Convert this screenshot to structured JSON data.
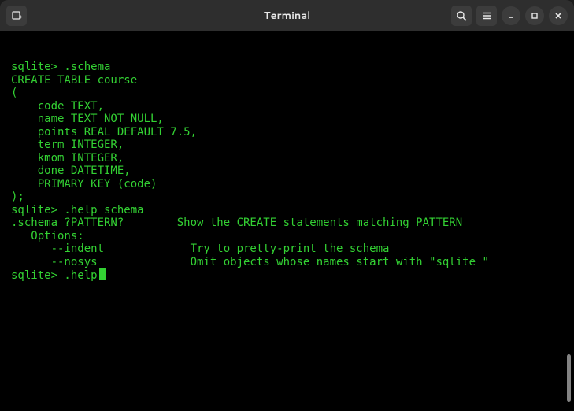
{
  "window": {
    "title": "Terminal"
  },
  "prompt": "sqlite> ",
  "lines": [
    {
      "text": "sqlite> .schema"
    },
    {
      "text": "CREATE TABLE course"
    },
    {
      "text": "("
    },
    {
      "text": "    code TEXT,"
    },
    {
      "text": "    name TEXT NOT NULL,"
    },
    {
      "text": "    points REAL DEFAULT 7.5,"
    },
    {
      "text": "    term INTEGER,"
    },
    {
      "text": "    kmom INTEGER,"
    },
    {
      "text": "    done DATETIME,"
    },
    {
      "text": ""
    },
    {
      "text": "    PRIMARY KEY (code)"
    },
    {
      "text": ");"
    },
    {
      "text": "sqlite> .help schema"
    },
    {
      "text": ".schema ?PATTERN?        Show the CREATE statements matching PATTERN"
    },
    {
      "text": "   Options:"
    },
    {
      "text": "      --indent             Try to pretty-print the schema"
    },
    {
      "text": "      --nosys              Omit objects whose names start with \"sqlite_\""
    },
    {
      "text": "sqlite> .help"
    }
  ],
  "icons": {
    "newtab": "new-tab-icon",
    "search": "search-icon",
    "menu": "hamburger-menu-icon",
    "minimize": "minimize-icon",
    "maximize": "maximize-icon",
    "close": "close-icon"
  }
}
